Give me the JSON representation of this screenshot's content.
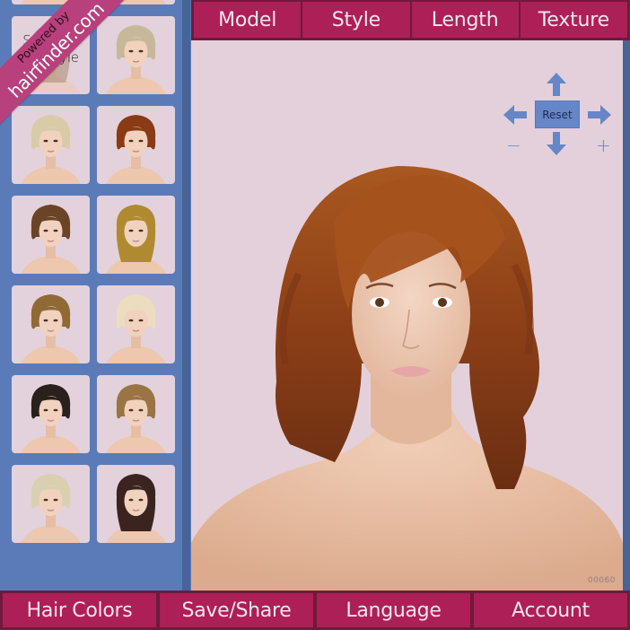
{
  "branding": {
    "powered_by": "Powered by",
    "site": "hairfinder.com"
  },
  "top_tabs": [
    {
      "label": "Model"
    },
    {
      "label": "Style"
    },
    {
      "label": "Length"
    },
    {
      "label": "Texture"
    }
  ],
  "bottom_tabs": [
    {
      "label": "Hair Colors"
    },
    {
      "label": "Save/Share"
    },
    {
      "label": "Language"
    },
    {
      "label": "Account"
    }
  ],
  "controls": {
    "reset_label": "Reset",
    "zoom_out_label": "−",
    "zoom_in_label": "+",
    "icons": [
      "arrow-up-icon",
      "arrow-down-icon",
      "arrow-left-icon",
      "arrow-right-icon"
    ]
  },
  "sidebar": {
    "selected_label_line1": "Selected",
    "selected_label_line2": "hairstyle",
    "thumbnails": [
      {
        "hair": "dark short pixie",
        "color": "#3a2a22"
      },
      {
        "hair": "medium layered brown with bangs",
        "color": "#7a5230"
      },
      {
        "hair": "selected - medium layered light brown",
        "color": "#a07a55",
        "selected": true
      },
      {
        "hair": "short platinum blonde bob",
        "color": "#c7b89a"
      },
      {
        "hair": "short platinum blonde quiff",
        "color": "#d8cba8"
      },
      {
        "hair": "short copper red pixie",
        "color": "#8a3a14"
      },
      {
        "hair": "short brown bowl cut",
        "color": "#6b4326"
      },
      {
        "hair": "long straight golden blonde",
        "color": "#b08a30"
      },
      {
        "hair": "short wavy golden brown",
        "color": "#8f6a35"
      },
      {
        "hair": "blonde bob with pink ombre",
        "color": "#ecdcc0"
      },
      {
        "hair": "short dark pixie",
        "color": "#2a201c"
      },
      {
        "hair": "light brown bob",
        "color": "#9a7444"
      },
      {
        "hair": "short blonde",
        "color": "#d8d0b0"
      },
      {
        "hair": "dark brown medium",
        "color": "#3b2420"
      }
    ]
  },
  "watermark": "00060",
  "colors": {
    "accent": "#ad1f57",
    "accent_dark": "#6e1a3c",
    "sidebar": "#5b7bb8",
    "stage_bg": "#e4d0da",
    "control": "#6686c8",
    "main_hair": "#9a4a1c"
  }
}
